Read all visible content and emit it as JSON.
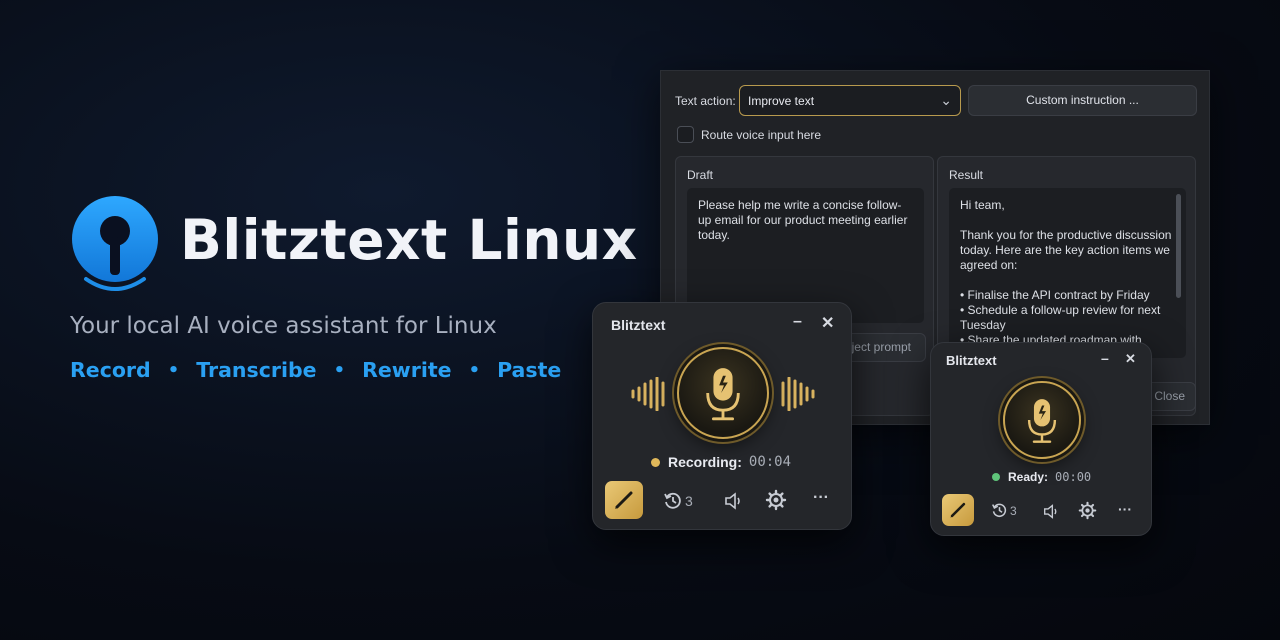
{
  "brand": {
    "title": "Blitztext Linux",
    "tagline": "Your local AI voice assistant for Linux",
    "features": [
      "Record",
      "Transcribe",
      "Rewrite",
      "Paste"
    ],
    "accent_color": "#2aa0f2"
  },
  "editor": {
    "text_action_label": "Text action:",
    "text_action_value": "Improve text",
    "custom_instruction_label": "Custom instruction ...",
    "route_voice_label": "Route voice input here",
    "route_voice_checked": false,
    "draft": {
      "title": "Draft",
      "text": "Please help me write a concise follow-up email for our product meeting earlier today."
    },
    "result": {
      "title": "Result",
      "greeting": "Hi team,",
      "intro": "Thank you for the productive discussion today. Here are the key action items we agreed on:",
      "bullets": [
        "• Finalise the API contract by Friday",
        "• Schedule a follow-up review for next Tuesday",
        "• Share the updated roadmap with"
      ]
    },
    "prompt_button_label": "ject prompt",
    "close_button_label": "Close"
  },
  "recorder_large": {
    "title": "Blitztext",
    "minimize_icon": "minimize-icon",
    "close_icon": "close-icon",
    "status_label": "Recording:",
    "status_time": "00:04",
    "status_color": "#e0b85a",
    "history_count": "3",
    "gold_color": "#d8b25f"
  },
  "recorder_small": {
    "title": "Blitztext",
    "status_label": "Ready:",
    "status_time": "00:00",
    "status_color": "#5fc47a",
    "history_count": "3"
  }
}
